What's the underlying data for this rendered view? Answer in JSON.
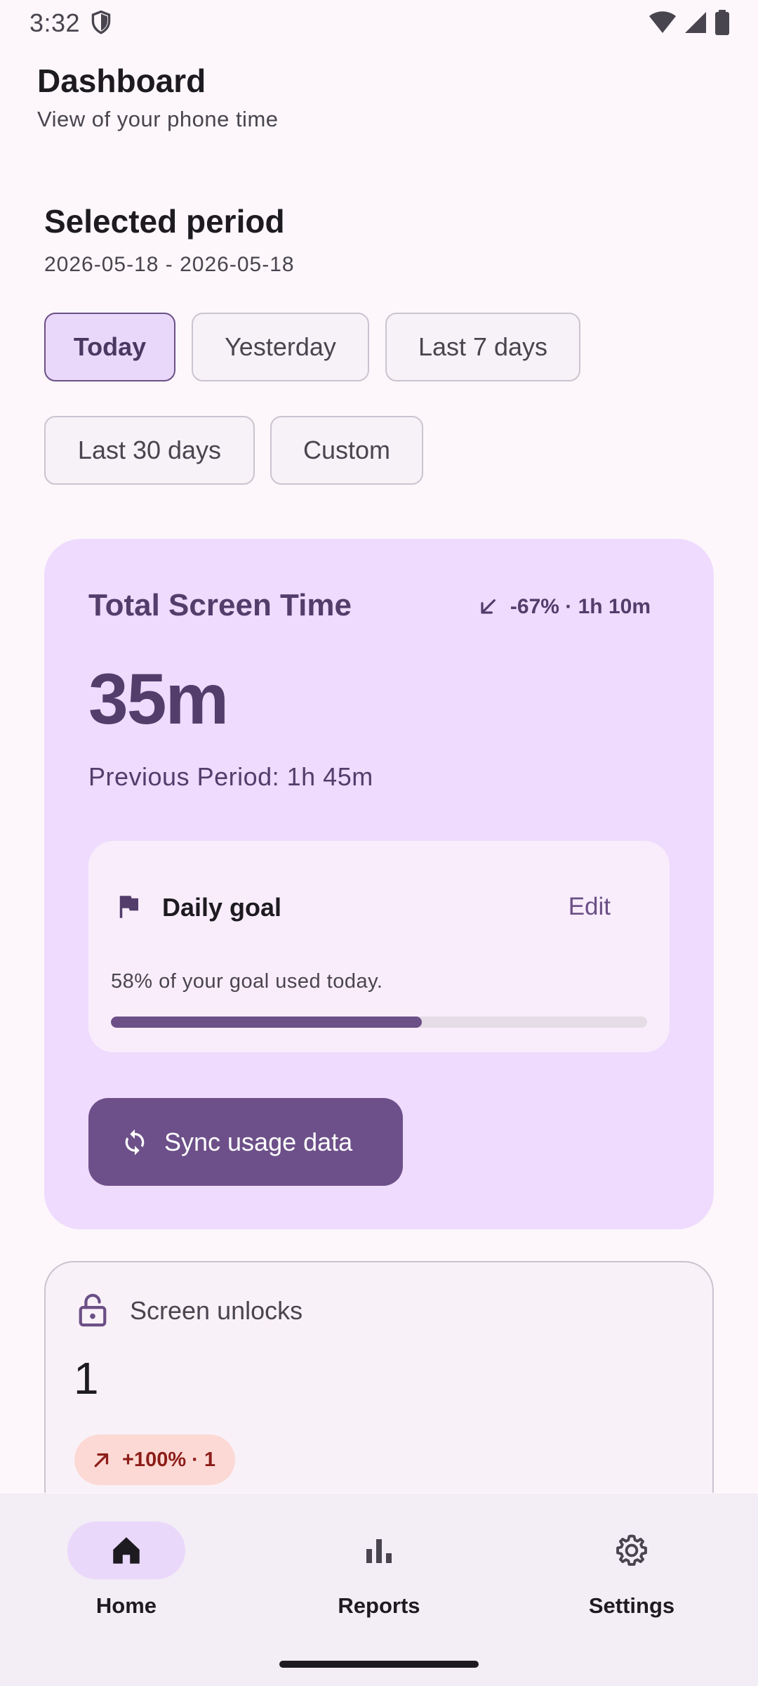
{
  "status_bar": {
    "time": "3:32",
    "icons": [
      "shield-icon",
      "wifi-icon",
      "signal-icon",
      "battery-icon"
    ]
  },
  "header": {
    "title": "Dashboard",
    "subtitle": "View of your phone time"
  },
  "period": {
    "title": "Selected period",
    "date_range": "2026-05-18 - 2026-05-18",
    "chips": [
      "Today",
      "Yesterday",
      "Last 7 days",
      "Last 30 days",
      "Custom"
    ],
    "selected": "Today"
  },
  "screen_time": {
    "title": "Total Screen Time",
    "trend": "-67% · 1h 10m",
    "trend_icon": "arrow-down-left-icon",
    "value": "35m",
    "previous": "Previous Period: 1h 45m"
  },
  "daily_goal": {
    "title": "Daily goal",
    "edit_label": "Edit",
    "text": "58% of your goal used today.",
    "progress": 0.58
  },
  "sync": {
    "label": "Sync usage data"
  },
  "unlocks": {
    "title": "Screen unlocks",
    "value": "1",
    "badge": "+100% · 1",
    "badge_icon": "arrow-up-right-icon"
  },
  "nav": {
    "items": [
      {
        "label": "Home",
        "icon": "home-icon",
        "active": true
      },
      {
        "label": "Reports",
        "icon": "bar-chart-icon",
        "active": false
      },
      {
        "label": "Settings",
        "icon": "gear-icon",
        "active": false
      }
    ]
  },
  "colors": {
    "accent": "#6d5089",
    "card_bg": "#eedbfd",
    "selected_chip": "#ead8fb",
    "badge_bg": "#fcd9d5",
    "badge_text": "#8c1d18"
  }
}
